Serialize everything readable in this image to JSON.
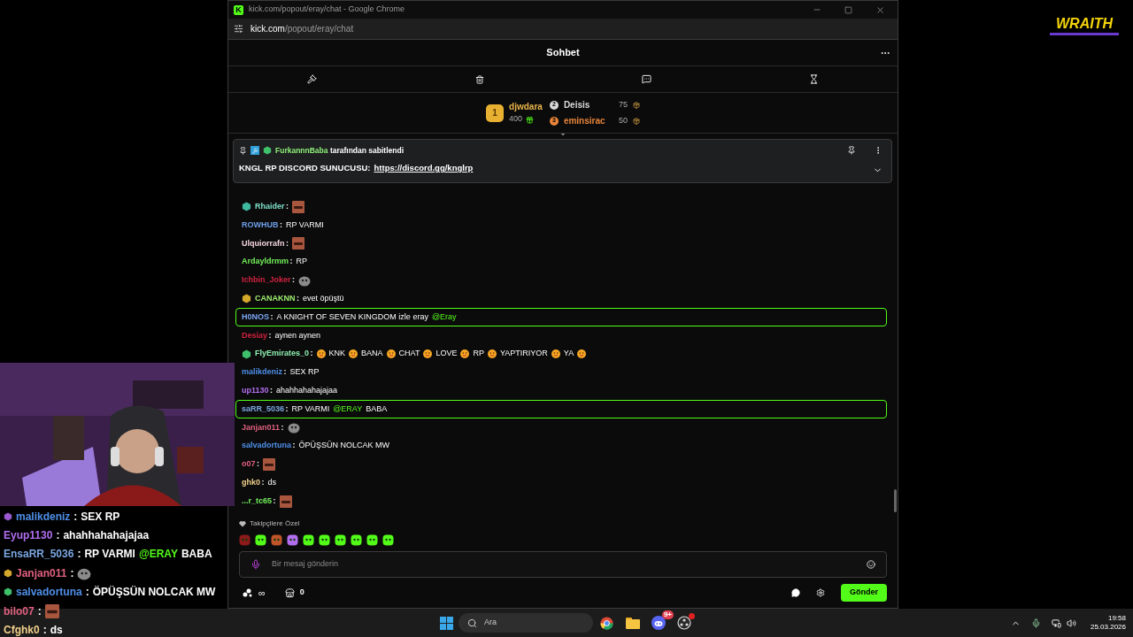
{
  "browser": {
    "app_letter": "K",
    "title": "kick.com/popout/eray/chat - Google Chrome",
    "url_host": "kick.com",
    "url_path": "/popout/eray/chat"
  },
  "chat": {
    "title": "Sohbet",
    "leaderboard": [
      {
        "rank": "1",
        "name": "djwdara",
        "amount": "400",
        "color": "#e8b44a"
      },
      {
        "rank": "2",
        "name": "Deisis",
        "amount": "75",
        "color": "#d9d9d9"
      },
      {
        "rank": "3",
        "name": "eminsirac",
        "amount": "50",
        "color": "#e8843a"
      }
    ],
    "pinned": {
      "by": "FurkannnBaba",
      "suffix": "tarafından sabitlendi",
      "text": "KNGL RP DISCORD SUNUCUSU:",
      "link": "https://discord.gg/knglrp"
    },
    "messages": [
      {
        "user": "Rhaider",
        "separator": ":",
        "color": "#7fe0c9",
        "badge": {
          "color": "#3fb8a0"
        },
        "highlighted": false,
        "parts": [
          {
            "kind": "face"
          }
        ]
      },
      {
        "user": "ROWHUB",
        "separator": ":",
        "color": "#6e9ee8",
        "highlighted": false,
        "parts": [
          {
            "kind": "text",
            "text": "RP VARMI"
          }
        ]
      },
      {
        "user": "Ulquiorrafn",
        "separator": ":",
        "color": "#f5d5e0",
        "highlighted": false,
        "parts": [
          {
            "kind": "face"
          }
        ]
      },
      {
        "user": "Ardayldrmm",
        "separator": ":",
        "color": "#72f05a",
        "highlighted": false,
        "parts": [
          {
            "kind": "text",
            "text": "RP"
          }
        ]
      },
      {
        "user": "Ichbin_Joker",
        "separator": ":",
        "color": "#d1223e",
        "highlighted": false,
        "parts": [
          {
            "kind": "cat"
          }
        ]
      },
      {
        "user": "CANAKNN",
        "separator": ":",
        "color": "#9ef06f",
        "badge": {
          "color": "#d4a82a"
        },
        "highlighted": false,
        "parts": [
          {
            "kind": "text",
            "text": "evet öpüştü"
          }
        ]
      },
      {
        "user": "H0NOS",
        "separator": ":",
        "color": "#7aa6f0",
        "highlighted": true,
        "parts": [
          {
            "kind": "text",
            "text": "A KNIGHT OF SEVEN KINGDOM izle eray"
          },
          {
            "kind": "mention",
            "text": "@Eray"
          }
        ]
      },
      {
        "user": "Desiay",
        "separator": ":",
        "color": "#d1223e",
        "highlighted": false,
        "parts": [
          {
            "kind": "text",
            "text": "aynen aynen"
          }
        ]
      },
      {
        "user": "FlyEmirates_0",
        "separator": ":",
        "color": "#8ff0b0",
        "badge": {
          "color": "#3fc06a"
        },
        "highlighted": false,
        "parts": [
          {
            "kind": "smiley"
          },
          {
            "kind": "text",
            "text": "KNK"
          },
          {
            "kind": "smiley"
          },
          {
            "kind": "text",
            "text": "BANA"
          },
          {
            "kind": "smiley"
          },
          {
            "kind": "text",
            "text": "CHAT"
          },
          {
            "kind": "smiley"
          },
          {
            "kind": "text",
            "text": "LOVE"
          },
          {
            "kind": "smiley"
          },
          {
            "kind": "text",
            "text": "RP"
          },
          {
            "kind": "smiley"
          },
          {
            "kind": "text",
            "text": "YAPTIRIYOR"
          },
          {
            "kind": "smiley"
          },
          {
            "kind": "text",
            "text": "YA"
          },
          {
            "kind": "smiley"
          }
        ]
      },
      {
        "user": "malikdeniz",
        "separator": ":",
        "color": "#4f8fe8",
        "highlighted": false,
        "parts": [
          {
            "kind": "text",
            "text": "SEX RP"
          }
        ]
      },
      {
        "user": "up1130",
        "separator": ":",
        "color": "#b36ef0",
        "highlighted": false,
        "parts": [
          {
            "kind": "text",
            "text": "ahahhahahajajaa"
          }
        ]
      },
      {
        "user": "saRR_5036",
        "separator": ":",
        "color": "#7aa6e0",
        "highlighted": true,
        "parts": [
          {
            "kind": "text",
            "text": "RP VARMI"
          },
          {
            "kind": "mention",
            "text": "@ERAY"
          },
          {
            "kind": "text",
            "text": "BABA"
          }
        ]
      },
      {
        "user": "Janjan011",
        "separator": ":",
        "color": "#e0607e",
        "highlighted": false,
        "parts": [
          {
            "kind": "cat"
          }
        ]
      },
      {
        "user": "salvadortuna",
        "separator": ":",
        "color": "#4f8fe8",
        "highlighted": false,
        "parts": [
          {
            "kind": "text",
            "text": "ÖPÜŞSÜN NOLCAK MW"
          }
        ]
      },
      {
        "user": "o07",
        "separator": ":",
        "color": "#e0607e",
        "highlighted": false,
        "parts": [
          {
            "kind": "face"
          }
        ]
      },
      {
        "user": "ghk0",
        "separator": ":",
        "color": "#f0d08a",
        "highlighted": false,
        "parts": [
          {
            "kind": "text",
            "text": "ds"
          }
        ]
      },
      {
        "user": "...r_tc65",
        "separator": ":",
        "color": "#72f05a",
        "highlighted": false,
        "parts": [
          {
            "kind": "face"
          }
        ]
      }
    ],
    "followers_only": "Takipçilere Özel",
    "emotes": [
      {
        "color": "#8b1a1a"
      },
      {
        "color": "#53fc18"
      },
      {
        "color": "#c0552a"
      },
      {
        "color": "#b36ef0"
      },
      {
        "color": "#53fc18"
      },
      {
        "color": "#53fc18"
      },
      {
        "color": "#53fc18"
      },
      {
        "color": "#53fc18"
      },
      {
        "color": "#53fc18"
      },
      {
        "color": "#53fc18"
      }
    ],
    "input": {
      "placeholder": "Bir mesaj gönderin"
    },
    "points": "∞",
    "store_count": "0",
    "send": "Gönder"
  },
  "overlay_chat": [
    {
      "user": "malikdeniz",
      "separator": ":",
      "color": "#4f8fe8",
      "badge": {
        "color": "#9b59d0"
      },
      "parts": [
        {
          "kind": "text",
          "text": "SEX RP"
        }
      ]
    },
    {
      "user": "Eyup1130",
      "separator": ":",
      "color": "#b36ef0",
      "parts": [
        {
          "kind": "text",
          "text": "ahahhahahajajaa"
        }
      ]
    },
    {
      "user": "EnsaRR_5036",
      "separator": ":",
      "color": "#7aa6e0",
      "parts": [
        {
          "kind": "text",
          "text": "RP VARMI"
        },
        {
          "kind": "mention",
          "text": "@ERAY"
        },
        {
          "kind": "text",
          "text": "BABA"
        }
      ]
    },
    {
      "user": "Janjan011",
      "separator": ":",
      "color": "#e0607e",
      "badge": {
        "color": "#d4a82a"
      },
      "parts": [
        {
          "kind": "cat"
        }
      ]
    },
    {
      "user": "salvadortuna",
      "separator": ":",
      "color": "#4f8fe8",
      "badge": {
        "color": "#3fc06a"
      },
      "parts": [
        {
          "kind": "text",
          "text": "ÖPÜŞSÜN NOLCAK MW"
        }
      ]
    },
    {
      "user": "bilo07",
      "separator": ":",
      "color": "#e0607e",
      "parts": [
        {
          "kind": "face"
        }
      ]
    },
    {
      "user": "Cfghk0",
      "separator": ":",
      "color": "#f0d08a",
      "parts": [
        {
          "kind": "text",
          "text": "ds"
        }
      ]
    }
  ],
  "logo": "WRAITH",
  "taskbar": {
    "search": "Ara",
    "discord_badge": "9+",
    "time": "19:58",
    "date": "25.03.2026"
  }
}
